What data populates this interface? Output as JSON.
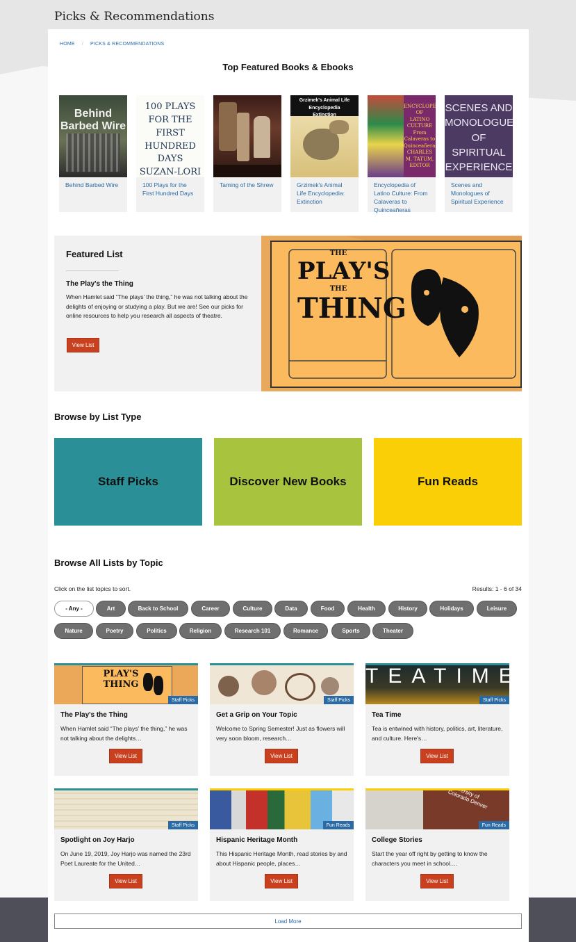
{
  "header": {
    "title": "Picks & Recommendations"
  },
  "breadcrumb": {
    "home": "HOME",
    "separator": "/",
    "current": "PICKS & RECOMMENDATIONS"
  },
  "featured_books": {
    "heading": "Top Featured Books & Ebooks",
    "items": [
      {
        "title": "Behind Barbed Wire",
        "cover_text": "Behind\nBarbed Wire"
      },
      {
        "title": "100 Plays for the First Hundred Days",
        "cover_text": "100 PLAYS\nFOR THE FIRST\nHUNDRED DAYS\nSUZAN-LORI PARKS"
      },
      {
        "title": "Taming of the Shrew",
        "cover_text": ""
      },
      {
        "title": "Grzimek's Animal Life Encyclopedia: Extinction",
        "cover_text": "Grzimek's Animal Life Encyclopedia\nExtinction"
      },
      {
        "title": "Encyclopedia of Latino Culture: From Calaveras to Quinceañeras",
        "cover_text": "ENCYCLOPEDIA OF\nLATINO\nCULTURE\nFrom Calaveras to Quinceañeras\nCHARLES M. TATUM, EDITOR"
      },
      {
        "title": "Scenes and Monologues of Spiritual Experience",
        "cover_text": "SCENES AND\nMONOLOGUES\nOF SPIRITUAL\nEXPERIENCE\nFROM THE BEST"
      }
    ]
  },
  "featured_list": {
    "heading": "Featured List",
    "title": "The Play's the Thing",
    "description": "When Hamlet said “The plays’ the thing,” he was not talking about the delights of enjoying or studying a play. But we are! See our picks for online resources to help you research all aspects of theatre.",
    "button": "View List",
    "image_text": [
      "THE",
      "PLAY'S",
      "THE",
      "THING"
    ]
  },
  "browse_type": {
    "heading": "Browse by List Type",
    "tiles": [
      {
        "label": "Staff Picks",
        "color": "#2a8f96"
      },
      {
        "label": "Discover New Books",
        "color": "#a8c43e"
      },
      {
        "label": "Fun Reads",
        "color": "#fbcf06"
      }
    ]
  },
  "browse_topic": {
    "heading": "Browse All Lists by Topic",
    "sort_note": "Click on the list topics to sort.",
    "results": "Results: 1 - 6 of 34",
    "topics": [
      "- Any -",
      "Art",
      "Back to School",
      "Career",
      "Culture",
      "Data",
      "Food",
      "Health",
      "History",
      "Holidays",
      "Leisure",
      "Nature",
      "Poetry",
      "Politics",
      "Religion",
      "Research 101",
      "Romance",
      "Sports",
      "Theater"
    ]
  },
  "cards": [
    {
      "title": "The Play's the Thing",
      "desc": "When Hamlet said “The plays’ the thing,” he was not talking about the delights…",
      "badge": "Staff Picks",
      "button": "View List",
      "bar": "#2a8f96",
      "image_text": "PLAY'S THING"
    },
    {
      "title": "Get a Grip on Your Topic",
      "desc": "Welcome to Spring Semester! Just as flowers will very soon bloom, research…",
      "badge": "Staff Picks",
      "button": "View List",
      "bar": "#2a8f96",
      "image_text": ""
    },
    {
      "title": "Tea Time",
      "desc": "Tea is entwined with history, politics, art, literature, and culture. Here's…",
      "badge": "Staff Picks",
      "button": "View List",
      "bar": "#2a8f96",
      "image_text": "TEATIME"
    },
    {
      "title": "Spotlight on Joy Harjo",
      "desc": "On June 19, 2019, Joy Harjo was named the 23rd Poet Laureate for the United…",
      "badge": "Staff Picks",
      "button": "View List",
      "bar": "#2a8f96",
      "image_text": ""
    },
    {
      "title": "Hispanic Heritage Month",
      "desc": "This Hispanic Heritage Month, read stories by and about Hispanic people, places…",
      "badge": "Fun Reads",
      "button": "View List",
      "bar": "#fbcf06",
      "image_text": ""
    },
    {
      "title": "College Stories",
      "desc": "Start the year off right by getting to know the characters you meet in school.…",
      "badge": "Fun Reads",
      "button": "View List",
      "bar": "#fbcf06",
      "image_text": "University of Colorado Denver"
    }
  ],
  "load_more": "Load More",
  "colors": {
    "accent_button": "#c9401f",
    "link": "#2a6aa5",
    "pill": "#6f6f6f"
  }
}
